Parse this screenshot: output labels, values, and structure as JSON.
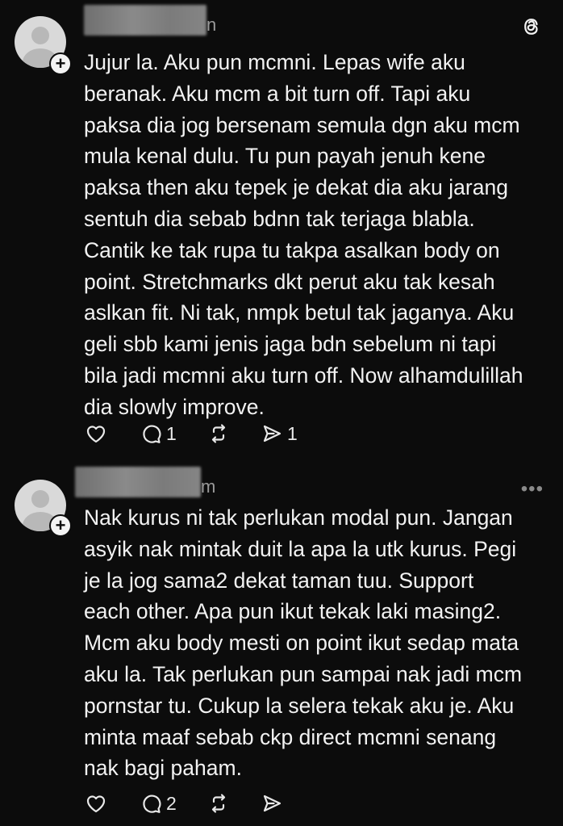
{
  "posts": [
    {
      "username_suffix": "n",
      "text": "Jujur la. Aku pun mcmni. Lepas wife aku\nberanak. Aku mcm a bit turn off. Tapi aku\npaksa dia jog bersenam semula dgn aku mcm\nmula kenal dulu. Tu pun payah jenuh kene\npaksa then aku tepek je dekat dia aku jarang\nsentuh dia sebab bdnn tak terjaga blabla.\nCantik ke tak rupa tu takpa asalkan body on\npoint. Stretchmarks dkt perut aku tak kesah\naslkan fit. Ni tak, nmpk betul tak jaganya. Aku\ngeli sbb kami jenis jaga bdn sebelum ni tapi\nbila jadi mcmni aku turn off. Now alhamdulillah\ndia slowly improve.",
      "reply_count": "1",
      "share_count": "1",
      "top_icon": "threads-logo-icon"
    },
    {
      "username_suffix": "m",
      "text": "Nak kurus ni tak perlukan modal pun. Jangan\nasyik nak mintak duit la apa la utk kurus. Pegi\nje la jog sama2 dekat taman tuu. Support\neach other. Apa pun ikut tekak laki masing2.\nMcm aku body mesti on point ikut sedap mata\naku la. Tak perlukan pun sampai nak jadi mcm\npornstar tu. Cukup la selera tekak aku je. Aku\nminta maaf sebab ckp direct mcmni senang\nnak bagi paham.",
      "reply_count": "2",
      "more_label": "•••",
      "top_icon": "more-icon"
    }
  ],
  "follow_label": "+",
  "colors": {
    "background": "#0c0c0c",
    "text": "#f2f2f2",
    "muted": "#8a8a8a",
    "avatar": "#d9d9d9"
  }
}
